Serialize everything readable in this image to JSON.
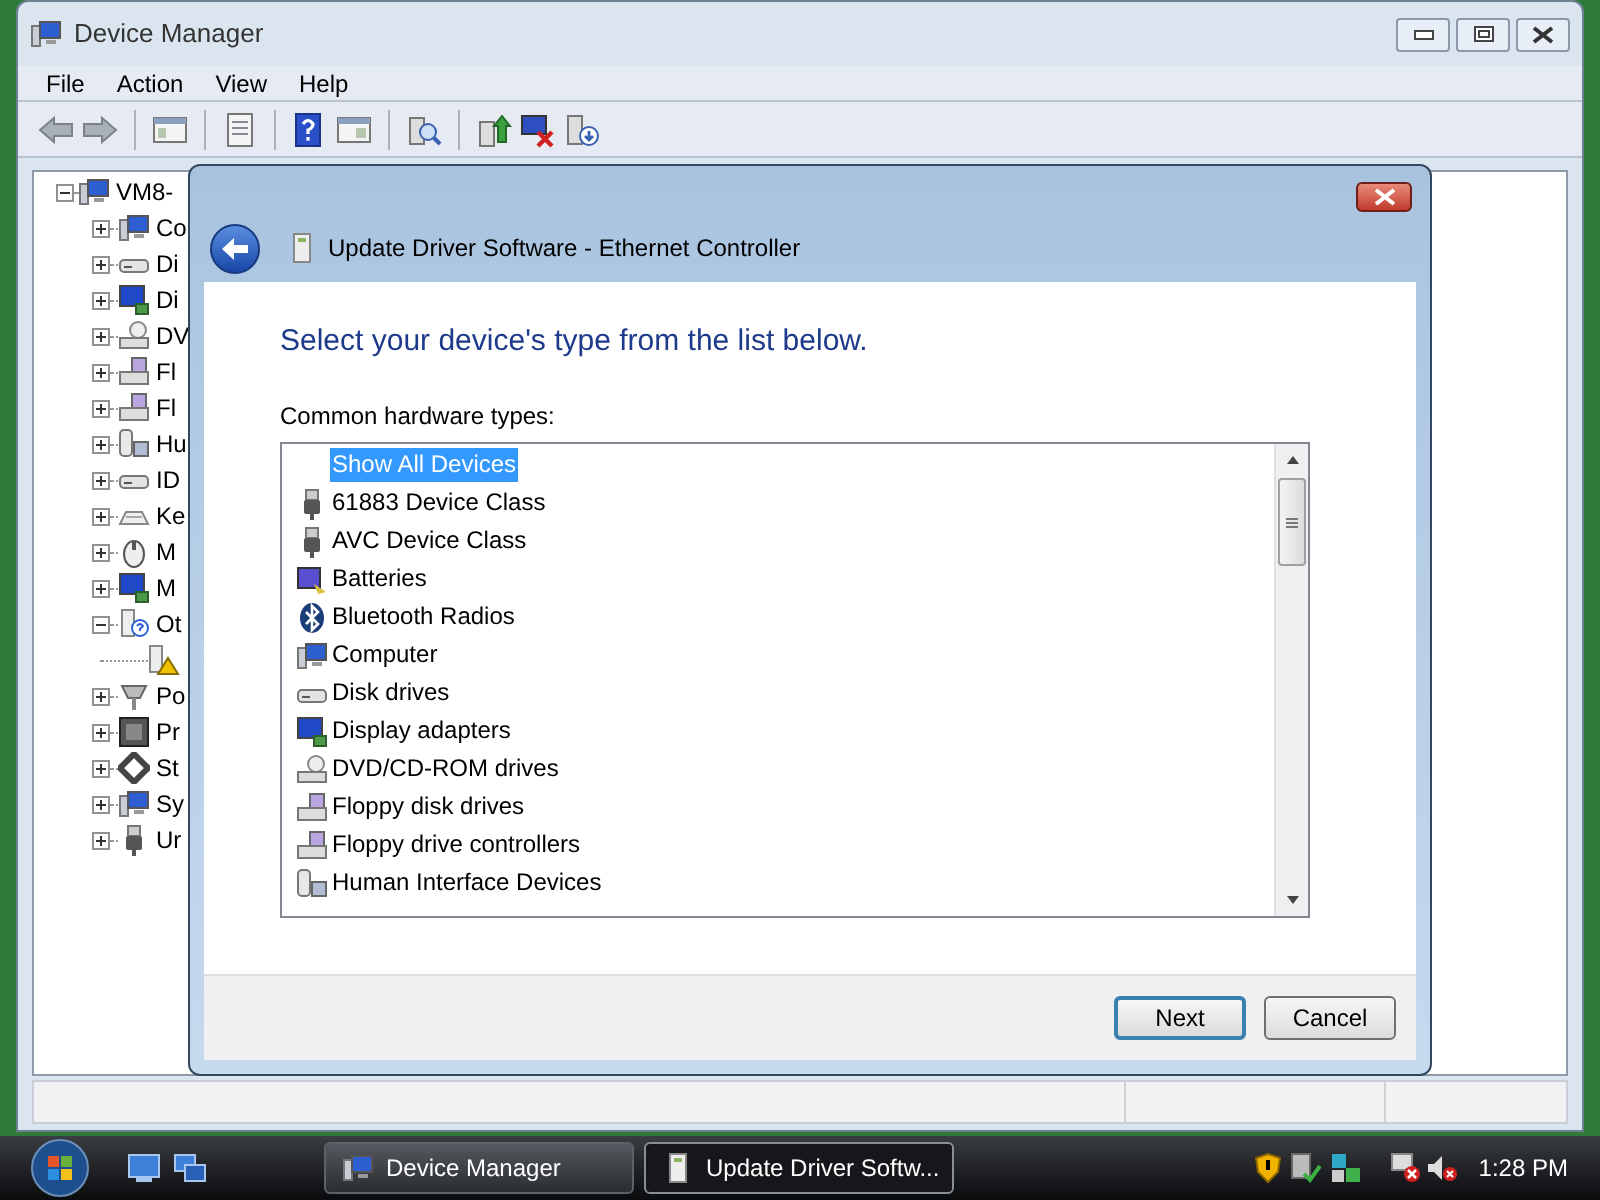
{
  "window": {
    "title": "Device Manager",
    "menu": [
      "File",
      "Action",
      "View",
      "Help"
    ]
  },
  "tree": {
    "label": "VM8-",
    "expanded": true,
    "children": [
      {
        "label": "Co",
        "expanded": false
      },
      {
        "label": "Di",
        "expanded": false
      },
      {
        "label": "Di",
        "expanded": false
      },
      {
        "label": "DV",
        "expanded": false
      },
      {
        "label": "Fl",
        "expanded": false
      },
      {
        "label": "Fl",
        "expanded": false
      },
      {
        "label": "Hu",
        "expanded": false
      },
      {
        "label": "ID",
        "expanded": false
      },
      {
        "label": "Ke",
        "expanded": false
      },
      {
        "label": "M",
        "expanded": false
      },
      {
        "label": "M",
        "expanded": false
      },
      {
        "label": "Ot",
        "expanded": true,
        "children": [
          {
            "warning": true
          }
        ]
      },
      {
        "label": "Po",
        "expanded": false
      },
      {
        "label": "Pr",
        "expanded": false
      },
      {
        "label": "St",
        "expanded": false
      },
      {
        "label": "Sy",
        "expanded": false
      },
      {
        "label": "Ur",
        "expanded": false
      }
    ]
  },
  "dialog": {
    "title": "Update Driver Software - Ethernet Controller",
    "heading": "Select your device's type from the list below.",
    "list_label": "Common hardware types:",
    "items": [
      {
        "label": "Show All Devices",
        "selected": true
      },
      {
        "label": "61883 Device Class",
        "selected": false
      },
      {
        "label": "AVC Device Class",
        "selected": false
      },
      {
        "label": "Batteries",
        "selected": false
      },
      {
        "label": "Bluetooth Radios",
        "selected": false
      },
      {
        "label": "Computer",
        "selected": false
      },
      {
        "label": "Disk drives",
        "selected": false
      },
      {
        "label": "Display adapters",
        "selected": false
      },
      {
        "label": "DVD/CD-ROM drives",
        "selected": false
      },
      {
        "label": "Floppy disk drives",
        "selected": false
      },
      {
        "label": "Floppy drive controllers",
        "selected": false
      },
      {
        "label": "Human Interface Devices",
        "selected": false
      }
    ],
    "buttons": [
      {
        "label": "Next",
        "default": true
      },
      {
        "label": "Cancel",
        "default": false
      }
    ]
  },
  "taskbar": {
    "tasks": [
      {
        "label": "Device Manager",
        "selected": false
      },
      {
        "label": "Update Driver Softw...",
        "selected": true
      }
    ],
    "clock": "1:28 PM"
  }
}
